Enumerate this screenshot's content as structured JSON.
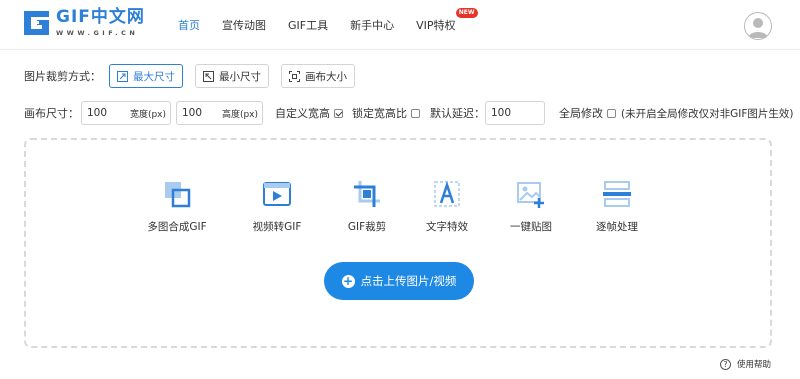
{
  "header": {
    "logo_title": "GIF中文网",
    "logo_sub": "WWW.GIF.CN",
    "nav": [
      {
        "label": "首页",
        "active": true
      },
      {
        "label": "宣传动图"
      },
      {
        "label": "GIF工具"
      },
      {
        "label": "新手中心"
      },
      {
        "label": "VIP特权",
        "badge": "NEW"
      }
    ]
  },
  "crop": {
    "label": "图片裁剪方式：",
    "options": [
      {
        "label": "最大尺寸",
        "icon": "maximize-icon",
        "active": true
      },
      {
        "label": "最小尺寸",
        "icon": "minimize-icon"
      },
      {
        "label": "画布大小",
        "icon": "canvas-size-icon"
      }
    ]
  },
  "settings": {
    "canvas_label": "画布尺寸：",
    "width_value": "100",
    "width_unit": "宽度(px)",
    "height_value": "100",
    "height_unit": "高度(px)",
    "custom_size_label": "自定义宽高",
    "custom_size_checked": true,
    "lock_ratio_label": "锁定宽高比",
    "lock_ratio_checked": false,
    "delay_label": "默认延迟：",
    "delay_value": "100",
    "global_label": "全局修改",
    "global_checked": false,
    "global_note": "(未开启全局修改仅对非GIF图片生效)"
  },
  "tools": [
    {
      "label": "多图合成GIF",
      "icon": "merge-images-icon"
    },
    {
      "label": "视频转GIF",
      "icon": "video-play-icon"
    },
    {
      "label": "GIF裁剪",
      "icon": "crop-icon"
    },
    {
      "label": "文字特效",
      "icon": "text-effect-icon"
    },
    {
      "label": "一键贴图",
      "icon": "add-image-icon"
    },
    {
      "label": "逐帧处理",
      "icon": "frame-edit-icon"
    }
  ],
  "upload_button": "点击上传图片/视频",
  "help_text": "使用帮助",
  "colors": {
    "accent": "#2e7fd8",
    "button": "#1e88e5",
    "icon_light": "#a9cbf0",
    "badge": "#e8332a"
  }
}
